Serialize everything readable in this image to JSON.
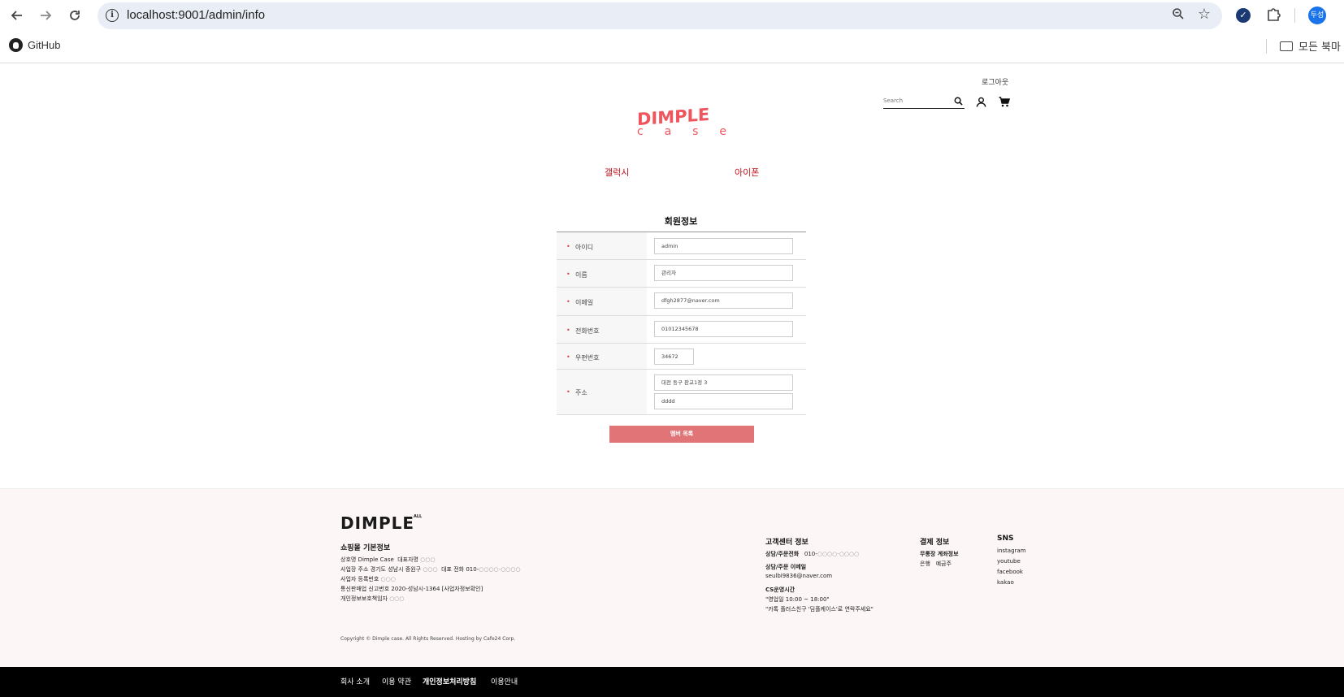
{
  "browser": {
    "url": "localhost:9001/admin/info",
    "profile_initials": "두성",
    "bookmarks": [
      {
        "label": "GitHub"
      }
    ],
    "all_bookmarks_label": "모든 북마"
  },
  "header": {
    "logout_label": "로그아웃",
    "search_placeholder": "Search",
    "logo_top": "DIMPLE",
    "logo_bottom": [
      "c",
      "a",
      "s",
      "e"
    ]
  },
  "menu": [
    {
      "label": "갤럭시"
    },
    {
      "label": "아이폰"
    }
  ],
  "form": {
    "title": "회원정보",
    "fields": [
      {
        "label": "아이디",
        "value": "admin"
      },
      {
        "label": "이름",
        "value": "관리자"
      },
      {
        "label": "이메일",
        "value": "dfgh2877@naver.com"
      },
      {
        "label": "전화번호",
        "value": "01012345678"
      },
      {
        "label": "우편번호",
        "value": "34672"
      },
      {
        "label": "주소",
        "value": "대전 동구 판교1정 3",
        "value2": "dddd"
      }
    ],
    "submit_label": "멤버 목록"
  },
  "footer": {
    "logo": "DIMPLE",
    "logo_sup": "ALL",
    "basic_info_title": "쇼핑몰 기본정보",
    "lines": [
      {
        "label": "상호명",
        "value": "Dimple Case",
        "label2": "대표자명",
        "value2": "○○○"
      },
      {
        "label": "사업장 주소",
        "value": "경기도 성남시 중원구",
        "muted": "○○○",
        "label2": "대표 전화",
        "value2": "010-",
        "muted2": "○○○○-○○○○"
      },
      {
        "label": "사업자 등록번호",
        "muted": "○○○"
      },
      {
        "label": "통신판매업 신고번호",
        "value": "2020-성남시-1364 [사업자정보확인]"
      },
      {
        "label": "개인정보보호책임자",
        "muted": "○○○"
      }
    ],
    "copyright": "Copyright © Dimple case. All Rights Reserved. Hosting by Cafe24 Corp.",
    "cs": {
      "title": "고객센터 정보",
      "phone_label": "상담/주문전화",
      "phone_value": "010-",
      "phone_muted": "○○○○-○○○○",
      "email_label": "상담/주문 이메일",
      "email_value": "seulbi9836@naver.com",
      "hours_label": "CS운영시간",
      "hours_line1": "\"영업일 10:00 ~ 18:00\"",
      "hours_line2": "\"카톡 플러스친구 '딤플케이스'로 연락주세요\""
    },
    "payment": {
      "title": "결제 정보",
      "account_label": "무통장 계좌정보",
      "bank": "은행",
      "holder": "예금주"
    },
    "sns": {
      "title": "SNS",
      "items": [
        "instagram",
        "youtube",
        "facebook",
        "kakao"
      ]
    },
    "bottom_links": [
      {
        "label": "회사 소개"
      },
      {
        "label": "이용 약관"
      },
      {
        "label": "개인정보처리방침"
      },
      {
        "label": "이용안내"
      }
    ]
  }
}
